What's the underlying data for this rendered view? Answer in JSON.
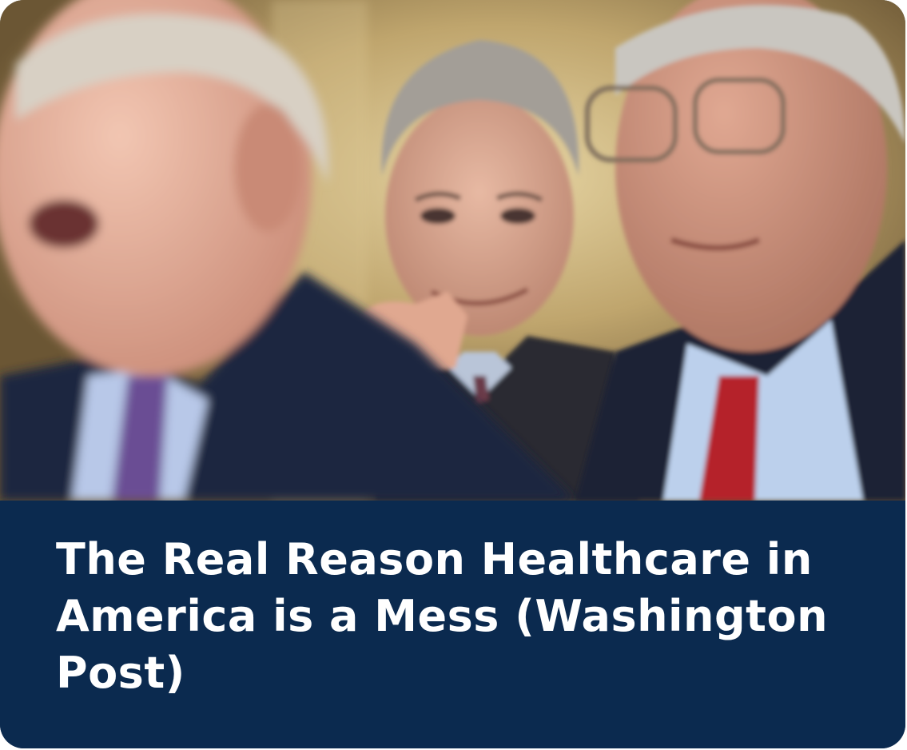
{
  "card": {
    "headline": "The Real Reason Healthcare in America is a Mess (Washington Post)",
    "image_subject": "photo-of-three-men-in-suits",
    "colors": {
      "caption_background": "#0b2a4f",
      "headline_text": "#ffffff"
    }
  }
}
